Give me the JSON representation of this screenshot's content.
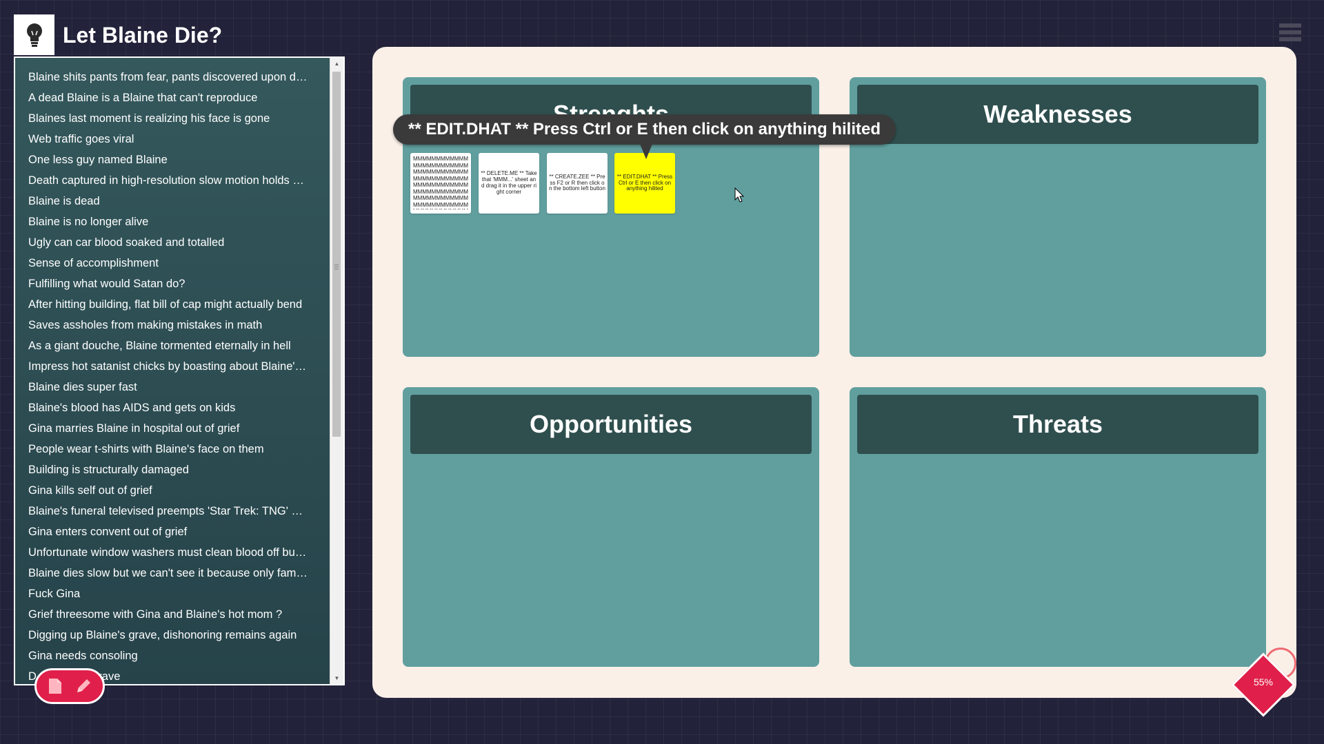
{
  "app": {
    "title": "Let Blaine Die?"
  },
  "ideas": [
    "Blaine shits pants from fear, pants discovered upon death",
    "A dead Blaine is a Blaine that can't reproduce",
    "Blaines last moment is realizing his face is gone",
    "Web traffic goes viral",
    "One less guy named Blaine",
    "Death captured in high-resolution slow motion holds up ...",
    "Blaine is dead",
    "Blaine is no longer alive",
    "Ugly can car blood soaked and totalled",
    "Sense of accomplishment",
    "Fulfilling what would Satan do?",
    "After hitting building, flat bill of cap might actually bend",
    "Saves assholes from making mistakes in math",
    "As a giant douche, Blaine tormented eternally in hell",
    "Impress hot satanist chicks by boasting about Blaine's d...",
    "Blaine dies super fast",
    "Blaine's blood has AIDS and gets on kids",
    "Gina marries Blaine in hospital out of grief",
    "People wear t-shirts with Blaine's face on them",
    "Building is structurally damaged",
    "Gina kills self out of grief",
    "Blaine's funeral televised preempts 'Star Trek: TNG' mar...",
    "Gina enters convent out of grief",
    "Unfortunate window washers must clean blood off building",
    "Blaine dies slow but we can't see it because only family ...",
    "Fuck Gina",
    "Grief threesome with Gina and Blaine's hot mom ?",
    "Digging up Blaine's grave, dishonoring remains again",
    "Gina needs consoling",
    "D... Blaine's grave"
  ],
  "board": {
    "strengths": "Strenghts",
    "weaknesses": "Weaknesses",
    "opportunities": "Opportunities",
    "threats": "Threats"
  },
  "notes": [
    "MMMMMMMMMMMMMMMMMMMMMMMMMMMMMMMMMMMMMMMMMMMMMMMMMMMMMMMMMMMMMMMMMMMMMMMMMMMMMMMMMMMMMMMMMMMMMMMMMMMMMMMMMMMMMMMMMMMM",
    "** DELETE.ME ** Take that 'MMM...' sheet and drag it in the upper right corner",
    "** CREATE.ZEE ** Press F2 or R then click on the bottom left button",
    "** EDIT.DHAT ** Press Ctrl or E then click on anything hilited"
  ],
  "tooltip": "** EDIT.DHAT ** Press Ctrl or E then click on anything hilited",
  "zoom": "55%"
}
